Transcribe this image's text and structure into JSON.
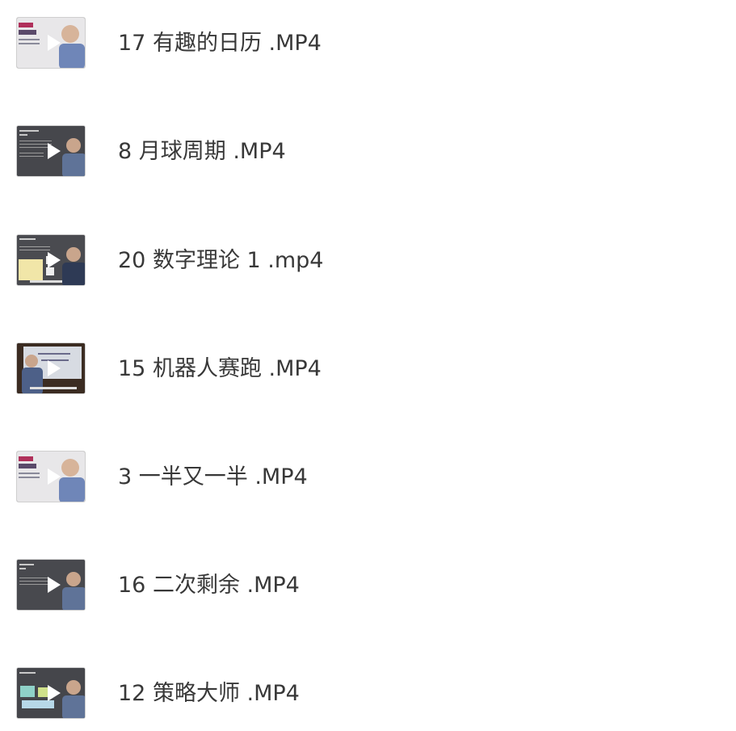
{
  "files": [
    {
      "name": "17 有趣的日历 .MP4",
      "thumb_style": "title-card"
    },
    {
      "name": "8 月球周期 .MP4",
      "thumb_style": "dark-slide"
    },
    {
      "name": "20 数字理论 1 .mp4",
      "thumb_style": "chart-slide"
    },
    {
      "name": "15 机器人赛跑 .MP4",
      "thumb_style": "board"
    },
    {
      "name": "3 一半又一半 .MP4",
      "thumb_style": "title-card"
    },
    {
      "name": "16 二次剩余 .MP4",
      "thumb_style": "dark-slide"
    },
    {
      "name": "12 策略大师 .MP4",
      "thumb_style": "diagram-slide"
    }
  ],
  "icons": {
    "play": "play-icon",
    "thumbnail": "video-thumbnail"
  }
}
